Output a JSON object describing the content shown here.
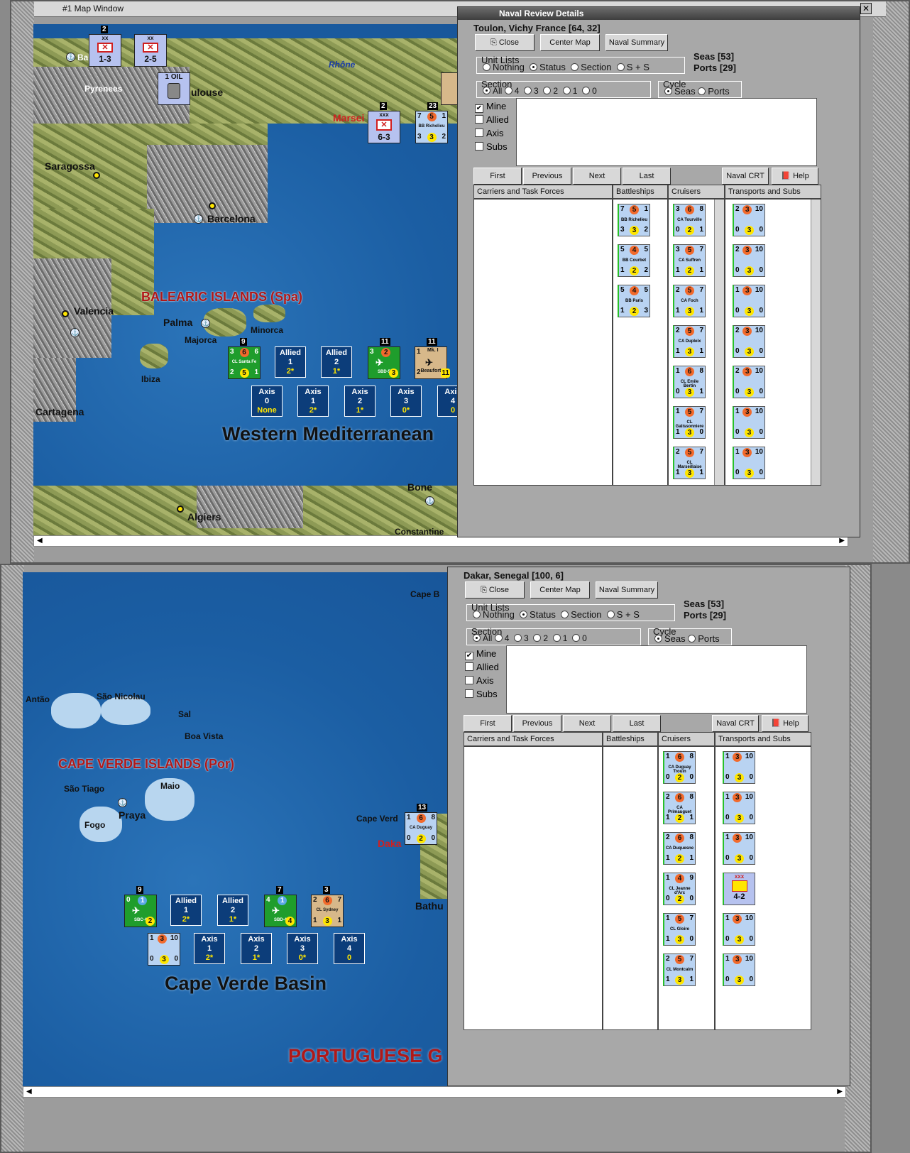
{
  "top_window": {
    "title": "#1 Map Window",
    "places": {
      "pyrenees": "Pyrenees",
      "toulouse": "ulouse",
      "rhone": "Rhône",
      "marseille": "Marsei",
      "saragossa": "Saragossa",
      "barcelona": "Barcelona",
      "valencia": "Valencia",
      "palma": "Palma",
      "majorca": "Majorca",
      "minorca": "Minorca",
      "ibiza": "Ibiza",
      "cartagena": "Cartagena",
      "algiers": "Algiers",
      "bone": "Bone",
      "constantine": "Constantine",
      "bayonne": "Ba",
      "balearic": "BALEARIC ISLANDS (Spa)",
      "sea": "Western Mediterranean"
    },
    "counters": {
      "c1": {
        "top": "xx",
        "mid": "1-3",
        "stack": "2"
      },
      "c2": {
        "top": "xx",
        "mid": "2-5"
      },
      "oil": {
        "label": "1 OIL"
      },
      "c3": {
        "top": "xxx",
        "mid": "6-3",
        "stack": "2"
      },
      "richelieu_map": {
        "tl": "7",
        "tm": "5",
        "tr": "1",
        "name": "BB Richelieu",
        "bl": "3",
        "bm": "3",
        "br": "2",
        "stack": "23"
      },
      "santa_fe": {
        "tl": "3",
        "tm": "6",
        "tr": "6",
        "name": "CL Santa Fe",
        "bl": "2",
        "bm": "5",
        "br": "1",
        "stack": "9"
      },
      "sbd5": {
        "tl": "3",
        "tm": "2",
        "tr": "",
        "name": "SBD-5",
        "bl": "",
        "bm": "3",
        "br": "",
        "stack": "11"
      },
      "beaufort": {
        "tl": "1",
        "tm": "Mk. I",
        "tr": "",
        "name": "Beaufort",
        "bl": "2",
        "bm": "",
        "br": "11",
        "stack": "11"
      }
    },
    "boxes": [
      {
        "a": "Allied",
        "b": "1",
        "c": "2*"
      },
      {
        "a": "Allied",
        "b": "2",
        "c": "1*"
      },
      {
        "a": "Axis",
        "b": "0",
        "c": "None"
      },
      {
        "a": "Axis",
        "b": "1",
        "c": "2*"
      },
      {
        "a": "Axis",
        "b": "2",
        "c": "1*"
      },
      {
        "a": "Axis",
        "b": "3",
        "c": "0*"
      },
      {
        "a": "Axis",
        "b": "4",
        "c": "0"
      }
    ]
  },
  "top_dialog": {
    "title": "Naval Review Details",
    "location": "Toulon, Vichy France [64, 32]",
    "close": "Close",
    "center": "Center Map",
    "summary": "Naval Summary",
    "unit_lists": "Unit Lists",
    "nothing": "Nothing",
    "status": "Status",
    "section_opt": "Section",
    "ss": "S + S",
    "seas": "Seas [53]",
    "ports": "Ports [29]",
    "section": "Section",
    "all": "All",
    "s4": "4",
    "s3": "3",
    "s2": "2",
    "s1": "1",
    "s0": "0",
    "cycle": "Cycle",
    "cseas": "Seas",
    "cports": "Ports",
    "mine": "Mine",
    "allied": "Allied",
    "axis": "Axis",
    "subs": "Subs",
    "first": "First",
    "previous": "Previous",
    "next": "Next",
    "last": "Last",
    "crt": "Naval CRT",
    "help": "Help",
    "h1": "Carriers and Task Forces",
    "h2": "Battleships",
    "h3": "Cruisers",
    "h4": "Transports and Subs",
    "battleships": [
      {
        "tl": "7",
        "tm": "5",
        "tr": "1",
        "name": "BB Richelieu",
        "bl": "3",
        "bm": "3",
        "br": "2"
      },
      {
        "tl": "5",
        "tm": "4",
        "tr": "5",
        "name": "BB Courbet",
        "bl": "1",
        "bm": "2",
        "br": "2"
      },
      {
        "tl": "5",
        "tm": "4",
        "tr": "5",
        "name": "BB Paris",
        "bl": "1",
        "bm": "2",
        "br": "3"
      }
    ],
    "cruisers": [
      {
        "tl": "3",
        "tm": "6",
        "tr": "8",
        "name": "CA Tourville",
        "bl": "0",
        "bm": "2",
        "br": "1"
      },
      {
        "tl": "3",
        "tm": "5",
        "tr": "7",
        "name": "CA Suffren",
        "bl": "1",
        "bm": "2",
        "br": "1"
      },
      {
        "tl": "2",
        "tm": "5",
        "tr": "7",
        "name": "CA Foch",
        "bl": "1",
        "bm": "3",
        "br": "1"
      },
      {
        "tl": "2",
        "tm": "5",
        "tr": "7",
        "name": "CA Dupleix",
        "bl": "1",
        "bm": "3",
        "br": "1"
      },
      {
        "tl": "1",
        "tm": "6",
        "tr": "8",
        "name": "CL Emile Bertin",
        "bl": "0",
        "bm": "3",
        "br": "1"
      },
      {
        "tl": "1",
        "tm": "5",
        "tr": "7",
        "name": "CL Galissonniere",
        "bl": "1",
        "bm": "3",
        "br": "0"
      },
      {
        "tl": "2",
        "tm": "5",
        "tr": "7",
        "name": "CL Marseillaise",
        "bl": "1",
        "bm": "3",
        "br": "1"
      }
    ],
    "transports": [
      {
        "tl": "2",
        "tm": "3",
        "tr": "10",
        "name": "",
        "bl": "0",
        "bm": "3",
        "br": "0"
      },
      {
        "tl": "2",
        "tm": "3",
        "tr": "10",
        "name": "",
        "bl": "0",
        "bm": "3",
        "br": "0"
      },
      {
        "tl": "1",
        "tm": "3",
        "tr": "10",
        "name": "",
        "bl": "0",
        "bm": "3",
        "br": "0"
      },
      {
        "tl": "2",
        "tm": "3",
        "tr": "10",
        "name": "",
        "bl": "0",
        "bm": "3",
        "br": "0"
      },
      {
        "tl": "2",
        "tm": "3",
        "tr": "10",
        "name": "",
        "bl": "0",
        "bm": "3",
        "br": "0"
      },
      {
        "tl": "1",
        "tm": "3",
        "tr": "10",
        "name": "",
        "bl": "0",
        "bm": "3",
        "br": "0"
      },
      {
        "tl": "1",
        "tm": "3",
        "tr": "10",
        "name": "",
        "bl": "0",
        "bm": "3",
        "br": "0"
      }
    ]
  },
  "bottom_window": {
    "places": {
      "antao": "Antão",
      "sao_nicolau": "São Nicolau",
      "sal": "Sal",
      "boa_vista": "Boa Vista",
      "sao_tiago": "São Tiago",
      "maio": "Maio",
      "fogo": "Fogo",
      "praya": "Praya",
      "cape_verde": "Cape Verd",
      "dakar": "Daka",
      "bathurst": "Bathu",
      "cape_b": "Cape B",
      "islands": "CAPE VERDE ISLANDS (Por)",
      "sea": "Cape Verde Basin",
      "portuguese": "PORTUGUESE G"
    },
    "counters": {
      "sbc4": {
        "tl": "0",
        "tm": "1",
        "tr": "",
        "name": "SBC-4",
        "bl": "",
        "bm": "2",
        "br": "",
        "stack": "9"
      },
      "sbd4": {
        "tl": "4",
        "tm": "1",
        "tr": "",
        "name": "SBD-4",
        "bl": "",
        "bm": "4",
        "br": "",
        "stack": "7"
      },
      "sydney": {
        "tl": "2",
        "tm": "6",
        "tr": "7",
        "name": "CL Sydney",
        "bl": "1",
        "bm": "3",
        "br": "1",
        "stack": "3"
      },
      "transport": {
        "tl": "1",
        "tm": "3",
        "tr": "10",
        "name": "",
        "bl": "0",
        "bm": "3",
        "br": "0"
      },
      "duguay_map": {
        "tl": "1",
        "tm": "6",
        "tr": "8",
        "name": "CA Duguay",
        "bl": "0",
        "bm": "2",
        "br": "0",
        "stack": "13"
      }
    },
    "boxes": [
      {
        "a": "Allied",
        "b": "1",
        "c": "2*"
      },
      {
        "a": "Allied",
        "b": "2",
        "c": "1*"
      },
      {
        "a": "Axis",
        "b": "1",
        "c": "2*"
      },
      {
        "a": "Axis",
        "b": "2",
        "c": "1*"
      },
      {
        "a": "Axis",
        "b": "3",
        "c": "0*"
      },
      {
        "a": "Axis",
        "b": "4",
        "c": "0"
      }
    ]
  },
  "bottom_dialog": {
    "location": "Dakar, Senegal [100, 6]",
    "close": "Close",
    "center": "Center Map",
    "summary": "Naval Summary",
    "unit_lists": "Unit Lists",
    "nothing": "Nothing",
    "status": "Status",
    "section_opt": "Section",
    "ss": "S + S",
    "seas": "Seas [53]",
    "ports": "Ports [29]",
    "section": "Section",
    "all": "All",
    "s4": "4",
    "s3": "3",
    "s2": "2",
    "s1": "1",
    "s0": "0",
    "cycle": "Cycle",
    "cseas": "Seas",
    "cports": "Ports",
    "mine": "Mine",
    "allied": "Allied",
    "axis": "Axis",
    "subs": "Subs",
    "first": "First",
    "previous": "Previous",
    "next": "Next",
    "last": "Last",
    "crt": "Naval CRT",
    "help": "Help",
    "h1": "Carriers and Task Forces",
    "h2": "Battleships",
    "h3": "Cruisers",
    "h4": "Transports and Subs",
    "cruisers": [
      {
        "tl": "1",
        "tm": "6",
        "tr": "8",
        "name": "CA Duguay Trouin",
        "bl": "0",
        "bm": "2",
        "br": "0"
      },
      {
        "tl": "2",
        "tm": "6",
        "tr": "8",
        "name": "CA Primauguet",
        "bl": "1",
        "bm": "2",
        "br": "1"
      },
      {
        "tl": "2",
        "tm": "6",
        "tr": "8",
        "name": "CA Duquesne",
        "bl": "1",
        "bm": "2",
        "br": "1"
      },
      {
        "tl": "1",
        "tm": "4",
        "tr": "9",
        "name": "CL Jeanne d'Arc",
        "bl": "0",
        "bm": "2",
        "br": "0"
      },
      {
        "tl": "1",
        "tm": "5",
        "tr": "7",
        "name": "CL Gloire",
        "bl": "1",
        "bm": "3",
        "br": "0"
      },
      {
        "tl": "2",
        "tm": "5",
        "tr": "7",
        "name": "CL Montcalm",
        "bl": "1",
        "bm": "3",
        "br": "1"
      }
    ],
    "transports": [
      {
        "tl": "1",
        "tm": "3",
        "tr": "10",
        "name": "",
        "bl": "0",
        "bm": "3",
        "br": "0"
      },
      {
        "tl": "1",
        "tm": "3",
        "tr": "10",
        "name": "",
        "bl": "0",
        "bm": "3",
        "br": "0"
      },
      {
        "tl": "1",
        "tm": "3",
        "tr": "10",
        "name": "",
        "bl": "0",
        "bm": "3",
        "br": "0"
      },
      {
        "tl": "",
        "tm": "xxx",
        "tr": "",
        "name": "",
        "bl": "",
        "bm": "4-2",
        "br": ""
      },
      {
        "tl": "1",
        "tm": "3",
        "tr": "10",
        "name": "",
        "bl": "0",
        "bm": "3",
        "br": "0"
      },
      {
        "tl": "1",
        "tm": "3",
        "tr": "10",
        "name": "",
        "bl": "0",
        "bm": "3",
        "br": "0"
      }
    ]
  }
}
